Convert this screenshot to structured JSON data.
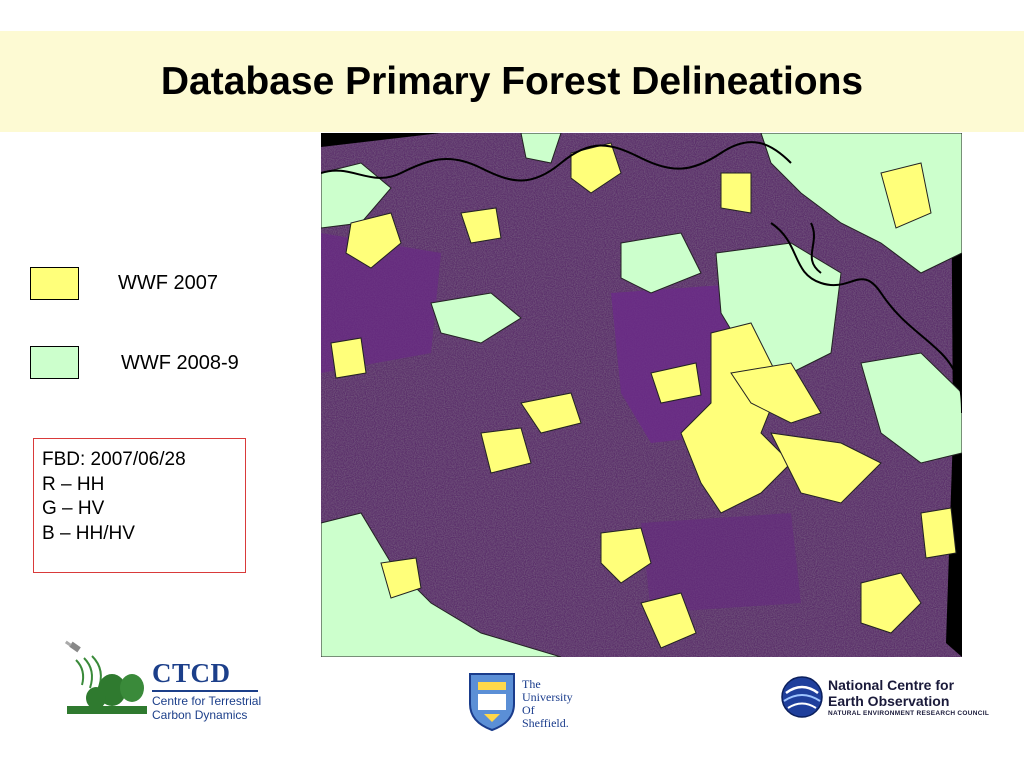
{
  "slide": {
    "title": "Database Primary Forest Delineations"
  },
  "legend": {
    "items": [
      {
        "label": "WWF 2007",
        "color": "#ffff7a"
      },
      {
        "label": "WWF 2008-9",
        "color": "#ccffcc"
      }
    ]
  },
  "info_box": {
    "lines": [
      "FBD: 2007/06/28",
      "R – HH",
      "G – HV",
      "B – HH/HV"
    ],
    "border_color": "#d93a3a"
  },
  "map": {
    "base_color": "#5a2e6a",
    "river_color": "#000000"
  },
  "logos": {
    "ctcd": {
      "name": "CTCD",
      "line1": "Centre for Terrestrial",
      "line2": "Carbon Dynamics",
      "icon": "satellite-trees-icon"
    },
    "sheffield": {
      "line1": "The",
      "line2": "University",
      "line3": "Of",
      "line4": "Sheffield.",
      "icon": "university-crest-icon"
    },
    "nceo": {
      "line1": "National Centre for",
      "line2": "Earth Observation",
      "line3": "NATURAL ENVIRONMENT RESEARCH COUNCIL",
      "icon": "globe-swirl-icon"
    }
  }
}
